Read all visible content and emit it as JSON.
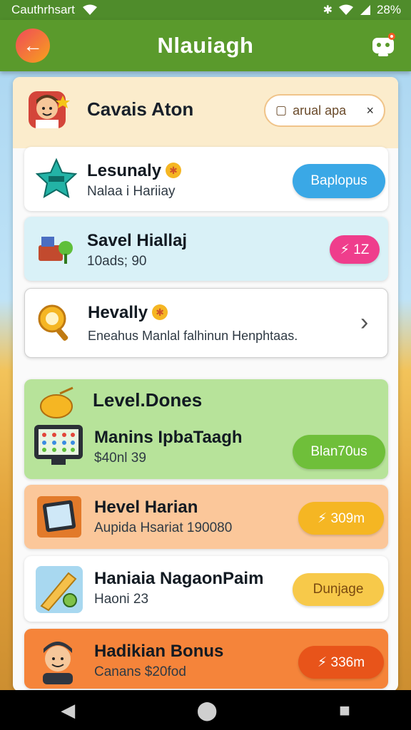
{
  "status": {
    "carrier": "Cauthrhsart",
    "battery": "28%"
  },
  "appbar": {
    "title": "Nlauiagh"
  },
  "header": {
    "name": "Cavais Aton",
    "chip_label": "arual apa",
    "chip_close": "×"
  },
  "cards": [
    {
      "title": "Lesunaly",
      "subtitle": "Nalaa i Hariiay",
      "action": "Baplopus"
    },
    {
      "title": "Savel Hiallaj",
      "subtitle": "10ads; 90",
      "action": "⚡ 1Z"
    },
    {
      "title": "Hevally",
      "subtitle": "Eneahus Manlal falhinun Henphtaas.",
      "action": "›"
    },
    {
      "title": "Manins IpbaTaagh",
      "subtitle": "$40nl 39",
      "action": "Blan70us"
    },
    {
      "title": "Hevel Harian",
      "subtitle": "Aupida Hsariat 190080",
      "action": "⚡ 309m"
    },
    {
      "title": "Haniaia NagaonPaim",
      "subtitle": "Haoni 23",
      "action": "Dunjage"
    },
    {
      "title": "Hadikian Bonus",
      "subtitle": "Canans $20fod",
      "action": "⚡ 336m"
    }
  ],
  "section": {
    "title": "Level.Dones"
  },
  "navbar": {
    "back": "◀",
    "home": "⬤",
    "recents": "■"
  },
  "colors": {
    "appbar": "#5a9a2c",
    "accent_blue": "#3aa8e6",
    "accent_green": "#6fbf3a"
  }
}
